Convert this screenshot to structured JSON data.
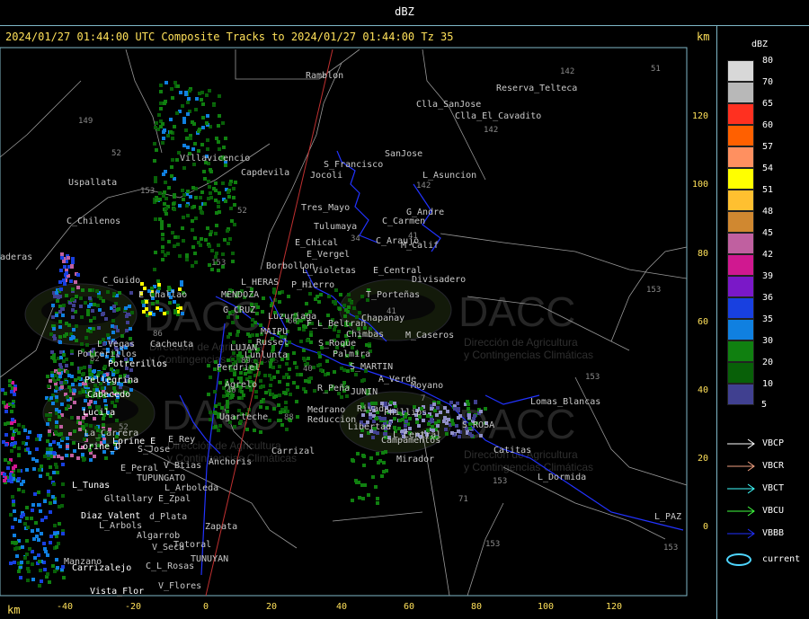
{
  "header": {
    "unit_title": "dBZ",
    "subtitle": "2024/01/27 01:44:00 UTC Composite Tracks to 2024/01/27 01:44:00 Tz 35",
    "km_label": "km"
  },
  "axes": {
    "x_unit": "km",
    "y_unit": "km",
    "x_ticks": [
      "-40",
      "-20",
      "0",
      "20",
      "40",
      "60",
      "80",
      "100",
      "120"
    ],
    "y_ticks": [
      "120",
      "100",
      "80",
      "60",
      "40",
      "20",
      "0"
    ]
  },
  "colorbar": {
    "unit": "dBZ",
    "levels": [
      {
        "label": "80",
        "color": "#d8d8d8"
      },
      {
        "label": "70",
        "color": "#b8b8b8"
      },
      {
        "label": "65",
        "color": "#ff3020"
      },
      {
        "label": "60",
        "color": "#ff6000"
      },
      {
        "label": "57",
        "color": "#ff9060"
      },
      {
        "label": "54",
        "color": "#ffff00"
      },
      {
        "label": "51",
        "color": "#ffc030"
      },
      {
        "label": "48",
        "color": "#d08830"
      },
      {
        "label": "45",
        "color": "#c060a0"
      },
      {
        "label": "42",
        "color": "#d01890"
      },
      {
        "label": "39",
        "color": "#7a18c8"
      },
      {
        "label": "36",
        "color": "#1840e0"
      },
      {
        "label": "35",
        "color": "#1080e0"
      },
      {
        "label": "30",
        "color": "#108010"
      },
      {
        "label": "20",
        "color": "#086008"
      },
      {
        "label": "10",
        "color": "#404090"
      },
      {
        "label": "5",
        "color": ""
      }
    ]
  },
  "tracks_legend": [
    {
      "label": "VBCP",
      "color": "#ffffff"
    },
    {
      "label": "VBCR",
      "color": "#f0a080"
    },
    {
      "label": "VBCT",
      "color": "#40ffff"
    },
    {
      "label": "VBCU",
      "color": "#40ff40"
    },
    {
      "label": "VBBB",
      "color": "#2030ff"
    },
    {
      "label": "current",
      "color": "#4fd6ff"
    }
  ],
  "watermark": {
    "name": "DACC",
    "line1": "Dirección de Agricultura",
    "line2": "y Contingencias Climáticas"
  },
  "places": [
    {
      "name": "Ramblon",
      "color": "#c8c8c8"
    },
    {
      "name": "Reserva_Telteca",
      "color": "#c8c8c8"
    },
    {
      "name": "Clla_SanJose",
      "color": "#c8c8c8"
    },
    {
      "name": "Clla_El_Cavadito",
      "color": "#c8c8c8"
    },
    {
      "name": "SanJose",
      "color": "#c8c8c8"
    },
    {
      "name": "L_Asuncion",
      "color": "#c8c8c8"
    },
    {
      "name": "S_Francisco",
      "color": "#c8c8c8"
    },
    {
      "name": "Jocoli",
      "color": "#c8c8c8"
    },
    {
      "name": "Villavicencio",
      "color": "#c8c8c8"
    },
    {
      "name": "Capdevila",
      "color": "#c8c8c8"
    },
    {
      "name": "Uspallata",
      "color": "#c8c8c8"
    },
    {
      "name": "Tres_Mayo",
      "color": "#c8c8c8"
    },
    {
      "name": "G_Andre",
      "color": "#c8c8c8"
    },
    {
      "name": "C_Chilenos",
      "color": "#c8c8c8"
    },
    {
      "name": "Tulumaya",
      "color": "#c8c8c8"
    },
    {
      "name": "C_Carmen",
      "color": "#c8c8c8"
    },
    {
      "name": "E_Chical",
      "color": "#c8c8c8"
    },
    {
      "name": "C_Araujo",
      "color": "#c8c8c8"
    },
    {
      "name": "M_Calif",
      "color": "#c8c8c8"
    },
    {
      "name": "E_Vergel",
      "color": "#c8c8c8"
    },
    {
      "name": "Borbollon",
      "color": "#c8c8c8"
    },
    {
      "name": "L_Violetas",
      "color": "#c8c8c8"
    },
    {
      "name": "E_Central",
      "color": "#c8c8c8"
    },
    {
      "name": "Divisadero",
      "color": "#c8c8c8"
    },
    {
      "name": "C_Guido",
      "color": "#c8c8c8"
    },
    {
      "name": "L_HERAS",
      "color": "#c8c8c8"
    },
    {
      "name": "P_Hierro",
      "color": "#c8c8c8"
    },
    {
      "name": "E_Challao",
      "color": "#c8c8c8"
    },
    {
      "name": "MENDOZA",
      "color": "#c8c8c8"
    },
    {
      "name": "T_Porteñas",
      "color": "#c8c8c8"
    },
    {
      "name": "G_CRUZ",
      "color": "#c8c8c8"
    },
    {
      "name": "Luzuriaga",
      "color": "#c8c8c8"
    },
    {
      "name": "Chapanay",
      "color": "#c8c8c8"
    },
    {
      "name": "MAIPU",
      "color": "#c8c8c8"
    },
    {
      "name": "F_L_Beltran",
      "color": "#c8c8c8"
    },
    {
      "name": "Chimbas",
      "color": "#c8c8c8"
    },
    {
      "name": "L_Vegas",
      "color": "#c8c8c8"
    },
    {
      "name": "Potrerillos",
      "color": "#c8c8c8"
    },
    {
      "name": "Cacheuta",
      "color": "#c8c8c8"
    },
    {
      "name": "Russel",
      "color": "#c8c8c8"
    },
    {
      "name": "S_Roque",
      "color": "#c8c8c8"
    },
    {
      "name": "M_Caseros",
      "color": "#c8c8c8"
    },
    {
      "name": "LUJAN",
      "color": "#c8c8c8"
    },
    {
      "name": "Lunlunta",
      "color": "#c8c8c8"
    },
    {
      "name": "Palmira",
      "color": "#c8c8c8"
    },
    {
      "name": "Potrerillos",
      "color": "#ffffff"
    },
    {
      "name": "Perdriel",
      "color": "#c8c8c8"
    },
    {
      "name": "S_MARTIN",
      "color": "#c8c8c8"
    },
    {
      "name": "Pellegrina",
      "color": "#ffffff"
    },
    {
      "name": "Agrelo",
      "color": "#c8c8c8"
    },
    {
      "name": "A_Verde",
      "color": "#c8c8c8"
    },
    {
      "name": "Moyano",
      "color": "#c8c8c8"
    },
    {
      "name": "Cabecedo",
      "color": "#ffffff"
    },
    {
      "name": "R_Peña",
      "color": "#c8c8c8"
    },
    {
      "name": "JUNIN",
      "color": "#c8c8c8"
    },
    {
      "name": "Lomas_Blancas",
      "color": "#c8c8c8"
    },
    {
      "name": "Lucila",
      "color": "#ffffff"
    },
    {
      "name": "Ugarteche",
      "color": "#c8c8c8"
    },
    {
      "name": "Medrano",
      "color": "#c8c8c8"
    },
    {
      "name": "Rivad",
      "color": "#c8c8c8"
    },
    {
      "name": "Phillips",
      "color": "#c8c8c8"
    },
    {
      "name": "Reduccion",
      "color": "#c8c8c8"
    },
    {
      "name": "S_ROSA",
      "color": "#c8c8c8"
    },
    {
      "name": "La_Carrera",
      "color": "#c8c8c8"
    },
    {
      "name": "Libertad",
      "color": "#c8c8c8"
    },
    {
      "name": "L_Central",
      "color": "#c8c8c8"
    },
    {
      "name": "E_Rey",
      "color": "#c8c8c8"
    },
    {
      "name": "Campamentos",
      "color": "#c8c8c8"
    },
    {
      "name": "Lorine_E",
      "color": "#ffffff"
    },
    {
      "name": "Lorine_O",
      "color": "#ffffff"
    },
    {
      "name": "S_Jose",
      "color": "#c8c8c8"
    },
    {
      "name": "Carrizal",
      "color": "#c8c8c8"
    },
    {
      "name": "Catitas",
      "color": "#c8c8c8"
    },
    {
      "name": "Anchoris",
      "color": "#c8c8c8"
    },
    {
      "name": "Mirador",
      "color": "#c8c8c8"
    },
    {
      "name": "E_Peral",
      "color": "#c8c8c8"
    },
    {
      "name": "V_Btias",
      "color": "#c8c8c8"
    },
    {
      "name": "L_Dormida",
      "color": "#c8c8c8"
    },
    {
      "name": "TUPUNGATO",
      "color": "#c8c8c8"
    },
    {
      "name": "L_Tunas",
      "color": "#ffffff"
    },
    {
      "name": "L_Arboleda",
      "color": "#c8c8c8"
    },
    {
      "name": "Gltallary",
      "color": "#c8c8c8"
    },
    {
      "name": "E_Zpal",
      "color": "#c8c8c8"
    },
    {
      "name": "Zapata",
      "color": "#c8c8c8"
    },
    {
      "name": "Diaz_Valent",
      "color": "#ffffff"
    },
    {
      "name": "d_Plata",
      "color": "#c8c8c8"
    },
    {
      "name": "L_PAZ",
      "color": "#c8c8c8"
    },
    {
      "name": "L_Arbols",
      "color": "#c8c8c8"
    },
    {
      "name": "Algarrob",
      "color": "#c8c8c8"
    },
    {
      "name": "V_Seca",
      "color": "#c8c8c8"
    },
    {
      "name": "Totoral",
      "color": "#c8c8c8"
    },
    {
      "name": "Manzano",
      "color": "#c8c8c8"
    },
    {
      "name": "TUNUYAN",
      "color": "#c8c8c8"
    },
    {
      "name": "Carrizalejo",
      "color": "#ffffff"
    },
    {
      "name": "C_L_Rosas",
      "color": "#c8c8c8"
    },
    {
      "name": "V_Flores",
      "color": "#c8c8c8"
    },
    {
      "name": "Vista_Flor",
      "color": "#ffffff"
    },
    {
      "name": "aderas",
      "color": "#c8c8c8"
    }
  ],
  "road_numbers": [
    "142",
    "51",
    "149",
    "142",
    "52",
    "142",
    "153",
    "153",
    "153",
    "153",
    "153",
    "52",
    "60",
    "40",
    "34",
    "41",
    "41",
    "7",
    "71",
    "153",
    "153",
    "82",
    "86",
    "89",
    "52",
    "88",
    "40"
  ]
}
